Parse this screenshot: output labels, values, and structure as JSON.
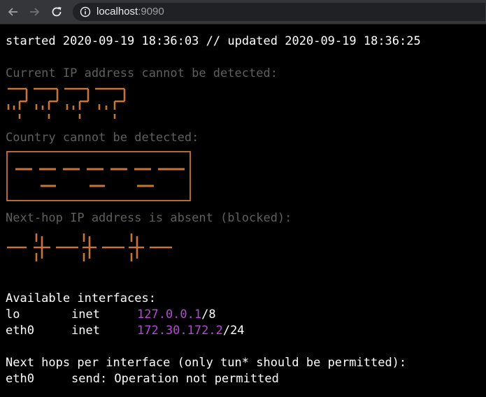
{
  "browser": {
    "url_host": "localhost",
    "url_port": ":9090"
  },
  "status": {
    "started_label": "started",
    "started_at": "2020-09-19 18:36:03",
    "separator": "//",
    "updated_label": "updated",
    "updated_at": "2020-09-19 18:36:25"
  },
  "ip_section": {
    "heading": "Current IP address cannot be detected:"
  },
  "country_section": {
    "heading": "Country cannot be detected:"
  },
  "nexthop_section": {
    "heading": "Next-hop IP address is absent (blocked):"
  },
  "interfaces": {
    "heading": "Available interfaces:",
    "rows": [
      {
        "name": "lo",
        "family": "inet",
        "address": "127.0.0.1",
        "prefix": "/8"
      },
      {
        "name": "eth0",
        "family": "inet",
        "address": "172.30.172.2",
        "prefix": "/24"
      }
    ]
  },
  "next_hops": {
    "heading": "Next hops per interface (only tun* should be permitted):",
    "rows": [
      {
        "name": "eth0",
        "message": "send: Operation not permitted"
      }
    ]
  },
  "colors": {
    "art": "#c8733a",
    "muted_text": "#5f5f5f",
    "address": "#b24bd1"
  },
  "icons": {
    "back": "arrow-left-icon",
    "forward": "arrow-right-icon",
    "reload": "reload-icon",
    "site_info": "info-icon"
  }
}
